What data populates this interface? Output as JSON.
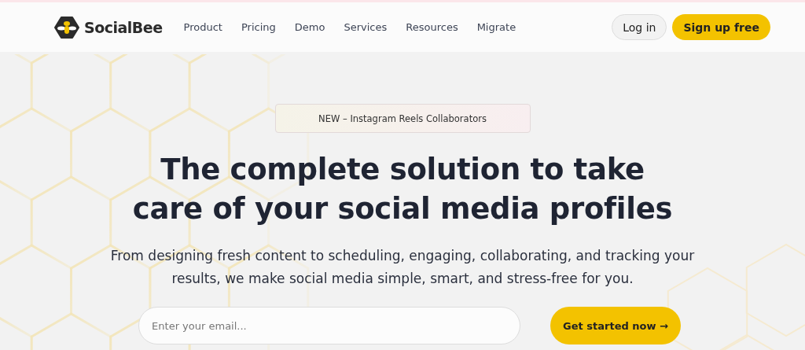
{
  "header": {
    "brand": "SocialBee",
    "nav": [
      {
        "label": "Product"
      },
      {
        "label": "Pricing"
      },
      {
        "label": "Demo"
      },
      {
        "label": "Services"
      },
      {
        "label": "Resources"
      },
      {
        "label": "Migrate"
      }
    ],
    "login": "Log in",
    "signup": "Sign up free"
  },
  "hero": {
    "announcement": "NEW – Instagram Reels Collaborators",
    "headline": [
      "The complete solution to take",
      "care of your social media profiles"
    ],
    "subtitle": "From designing fresh content to scheduling, engaging, collaborating, and tracking your results, we make social media simple, smart, and stress-free for you.",
    "email": {
      "placeholder": "Enter your email..."
    },
    "cta": "Get started now →"
  }
}
